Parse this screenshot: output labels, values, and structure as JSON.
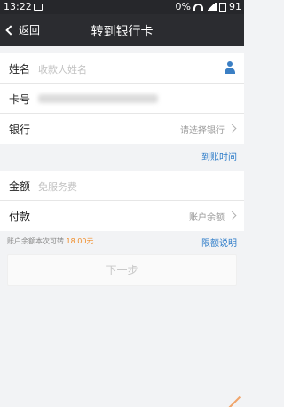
{
  "status_bar": {
    "time": "13:22",
    "battery_pct": "0%",
    "battery": "91"
  },
  "nav": {
    "back_label": "返回",
    "title": "转到银行卡"
  },
  "form": {
    "name": {
      "label": "姓名",
      "placeholder": "收款人姓名"
    },
    "card": {
      "label": "卡号"
    },
    "bank": {
      "label": "银行",
      "value": "请选择银行"
    },
    "arrival_time_link": "到账时间",
    "amount": {
      "label": "金额",
      "placeholder": "免服务费"
    },
    "payment": {
      "label": "付款",
      "value": "账户余额"
    }
  },
  "note": {
    "prefix": "账户余额本次可转",
    "amount": "18.00元"
  },
  "limit_link": "限额说明",
  "next_button": "下一步"
}
